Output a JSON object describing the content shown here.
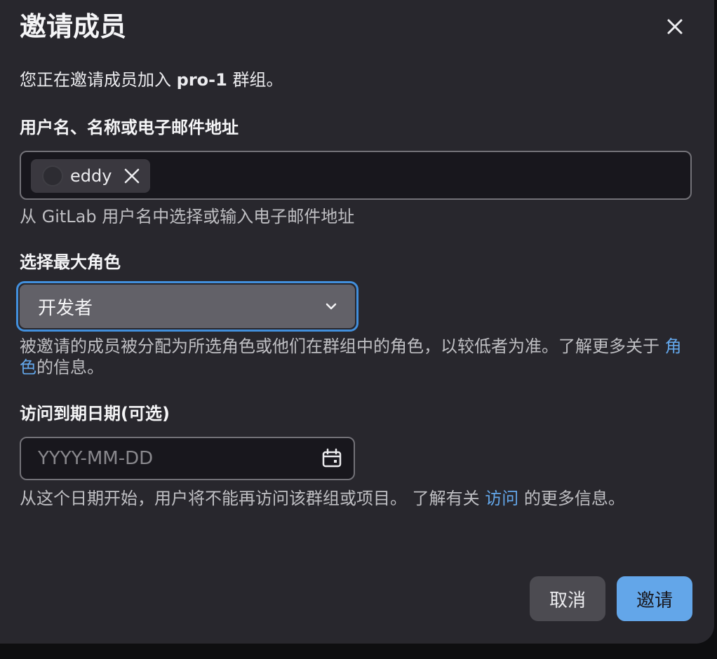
{
  "modal": {
    "title": "邀请成员",
    "close_icon": "close-icon"
  },
  "intro": {
    "prefix": "您正在邀请成员加入 ",
    "group": "pro-1",
    "suffix": " 群组。"
  },
  "invitee": {
    "label": "用户名、名称或电子邮件地址",
    "tokens": [
      {
        "name": "eddy",
        "avatar_icon": "avatar-placeholder",
        "remove_icon": "close-icon"
      }
    ],
    "help": "从 GitLab 用户名中选择或输入电子邮件地址"
  },
  "role": {
    "label": "选择最大角色",
    "selected": "开发者",
    "dropdown_icon": "chevron-down-icon",
    "help_prefix": "被邀请的成员被分配为所选角色或他们在群组中的角色，以较低者为准。了解更多关于 ",
    "help_link": "角色",
    "help_suffix": "的信息。"
  },
  "expiry": {
    "label": "访问到期日期(可选)",
    "placeholder": "YYYY-MM-DD",
    "value": "",
    "calendar_icon": "calendar-icon",
    "help_prefix": "从这个日期开始，用户将不能再访问该群组或项目。 了解有关 ",
    "help_link": "访问",
    "help_suffix": " 的更多信息。"
  },
  "footer": {
    "cancel_label": "取消",
    "invite_label": "邀请"
  },
  "colors": {
    "background": "#28272d",
    "accent": "#63a6e9",
    "focus_ring": "#428fdc"
  }
}
